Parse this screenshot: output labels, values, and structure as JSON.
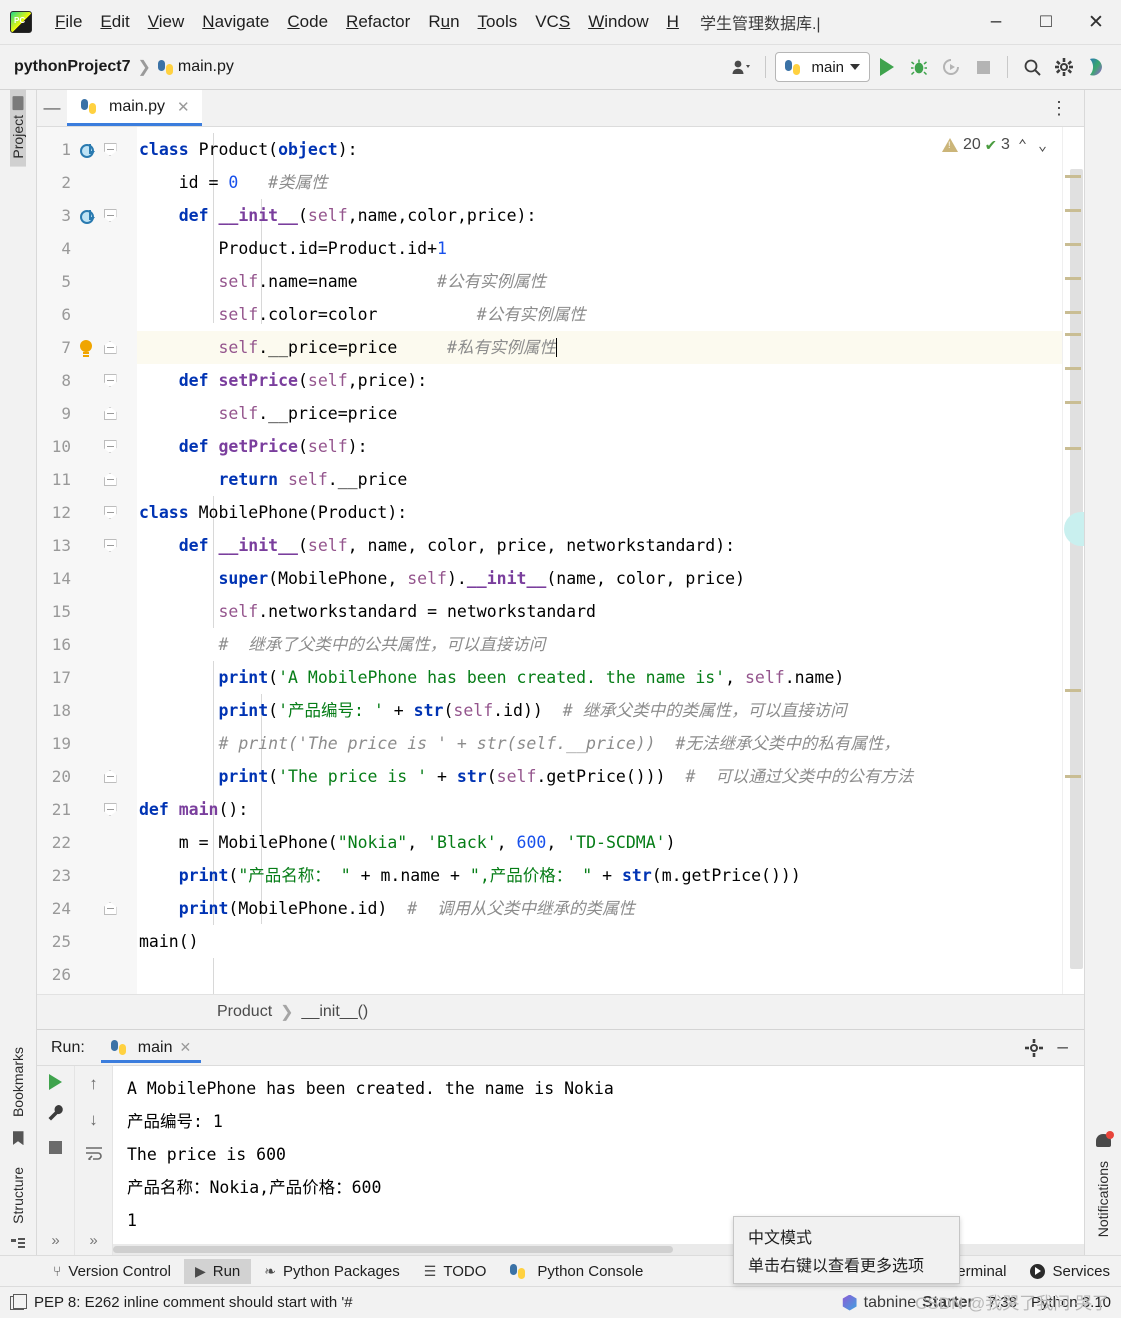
{
  "window": {
    "app_icon": "pycharm-logo-icon",
    "title": "学生管理数据库.|",
    "menus": [
      {
        "label": "File",
        "mnemonic": "F"
      },
      {
        "label": "Edit",
        "mnemonic": "E"
      },
      {
        "label": "View",
        "mnemonic": "V"
      },
      {
        "label": "Navigate",
        "mnemonic": "N"
      },
      {
        "label": "Code",
        "mnemonic": "C"
      },
      {
        "label": "Refactor",
        "mnemonic": "R"
      },
      {
        "label": "Run",
        "mnemonic": "u"
      },
      {
        "label": "Tools",
        "mnemonic": "T"
      },
      {
        "label": "VCS",
        "mnemonic": "S"
      },
      {
        "label": "Window",
        "mnemonic": "W"
      },
      {
        "label": "H",
        "mnemonic": "H"
      }
    ],
    "controls": {
      "minimize": "–",
      "maximize": "□",
      "close": "✕"
    }
  },
  "navbar": {
    "project": "pythonProject7",
    "separator": "❯",
    "file": "main.py",
    "run_config": "main",
    "icons": {
      "account": "account-icon",
      "run": "run-icon",
      "debug": "debug-icon",
      "coverage": "run-with-coverage-icon",
      "stop": "stop-icon",
      "search": "search-icon",
      "settings": "settings-gear-icon",
      "ai": "ai-assistant-icon"
    }
  },
  "left_rail": {
    "project_tab": "Project",
    "bookmarks_tab": "Bookmarks",
    "structure_tab": "Structure"
  },
  "right_rail": {
    "notifications_tab": "Notifications"
  },
  "editor": {
    "tab": {
      "name": "main.py",
      "close": "✕"
    },
    "more_actions": "⋮",
    "inspection": {
      "warnings": "20",
      "checks": "3",
      "prev": "⌃",
      "next": "⌄"
    },
    "breadcrumb": {
      "class": "Product",
      "sep": "❯",
      "method": "__init__()"
    },
    "lines": [
      {
        "n": "1",
        "gutter": "run",
        "fold": "down"
      },
      {
        "n": "2",
        "gutter": "",
        "fold": ""
      },
      {
        "n": "3",
        "gutter": "run",
        "fold": "down"
      },
      {
        "n": "4",
        "gutter": "",
        "fold": ""
      },
      {
        "n": "5",
        "gutter": "",
        "fold": ""
      },
      {
        "n": "6",
        "gutter": "",
        "fold": ""
      },
      {
        "n": "7",
        "gutter": "bulb",
        "fold": "up"
      },
      {
        "n": "8",
        "gutter": "",
        "fold": "down"
      },
      {
        "n": "9",
        "gutter": "",
        "fold": "up"
      },
      {
        "n": "10",
        "gutter": "",
        "fold": "down"
      },
      {
        "n": "11",
        "gutter": "",
        "fold": "up"
      },
      {
        "n": "12",
        "gutter": "",
        "fold": "down"
      },
      {
        "n": "13",
        "gutter": "",
        "fold": "down"
      },
      {
        "n": "14",
        "gutter": "",
        "fold": ""
      },
      {
        "n": "15",
        "gutter": "",
        "fold": ""
      },
      {
        "n": "16",
        "gutter": "",
        "fold": ""
      },
      {
        "n": "17",
        "gutter": "",
        "fold": ""
      },
      {
        "n": "18",
        "gutter": "",
        "fold": ""
      },
      {
        "n": "19",
        "gutter": "",
        "fold": ""
      },
      {
        "n": "20",
        "gutter": "",
        "fold": "up"
      },
      {
        "n": "21",
        "gutter": "",
        "fold": "down"
      },
      {
        "n": "22",
        "gutter": "",
        "fold": ""
      },
      {
        "n": "23",
        "gutter": "",
        "fold": ""
      },
      {
        "n": "24",
        "gutter": "",
        "fold": "up"
      },
      {
        "n": "25",
        "gutter": "",
        "fold": ""
      },
      {
        "n": "26",
        "gutter": "",
        "fold": ""
      }
    ],
    "code_plain": [
      "class Product(object):",
      "    id = 0   #类属性",
      "    def __init__(self,name,color,price):",
      "        Product.id=Product.id+1",
      "        self.name=name        #公有实例属性",
      "        self.color=color          #公有实例属性",
      "        self.__price=price     #私有实例属性",
      "    def setPrice(self,price):",
      "        self.__price=price",
      "    def getPrice(self):",
      "        return self.__price",
      "class MobilePhone(Product):",
      "    def __init__(self, name, color, price, networkstandard):",
      "        super(MobilePhone, self).__init__(name, color, price)",
      "        self.networkstandard = networkstandard",
      "        #  继承了父类中的公共属性，可以直接访问",
      "        print('A MobilePhone has been created. the name is', self.name)",
      "        print('产品编号: ' + str(self.id))  # 继承父类中的类属性，可以直接访问",
      "        # print('The price is ' + str(self.__price))  #无法继承父类中的私有属性，",
      "        print('The price is ' + str(self.getPrice()))  #  可以通过父类中的公有方法",
      "def main():",
      "    m = MobilePhone(\"Nokia\", 'Black', 600, 'TD-SCDMA')",
      "    print(\"产品名称： \" + m.name + \",产品价格： \" + str(m.getPrice()))",
      "    print(MobilePhone.id)  #  调用从父类中继承的类属性",
      "main()",
      ""
    ]
  },
  "run_panel": {
    "label": "Run:",
    "tab": {
      "name": "main",
      "close": "✕"
    },
    "settings_icon": "gear-icon",
    "minimize_icon": "–",
    "rail_icons": [
      "rerun-icon",
      "wrench-icon",
      "stop-icon",
      "more-icon"
    ],
    "rail2_icons": [
      "scroll-up-icon",
      "scroll-down-icon",
      "soft-wrap-icon",
      "more-icon"
    ],
    "output": [
      "A MobilePhone has been created. the name is Nokia",
      "产品编号: 1",
      "The price is 600",
      "产品名称：Nokia,产品价格：600",
      "1"
    ]
  },
  "bottom_tabs": [
    {
      "label": "Version Control",
      "icon": "branch-icon",
      "active": false
    },
    {
      "label": "Run",
      "icon": "run-icon",
      "active": true
    },
    {
      "label": "Python Packages",
      "icon": "packages-icon",
      "active": false
    },
    {
      "label": "TODO",
      "icon": "todo-list-icon",
      "active": false
    },
    {
      "label": "Python Console",
      "icon": "python-icon",
      "active": false
    },
    {
      "label": "Terminal",
      "icon": "terminal-icon",
      "active": false
    },
    {
      "label": "Services",
      "icon": "services-icon",
      "active": false
    }
  ],
  "statusbar": {
    "message": "PEP 8: E262 inline comment should start with '#",
    "tabnine": "tabnine",
    "tabnine_plan": "Starter",
    "time": "7:38",
    "interpreter": "Python 3.10",
    "message_icon": "copy-icon"
  },
  "tooltip": {
    "line1": "中文模式",
    "line2": "单击右键以查看更多选项"
  },
  "watermark": "CSDN @我哭了我问 哭了"
}
